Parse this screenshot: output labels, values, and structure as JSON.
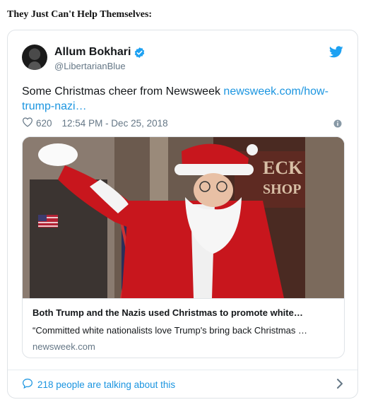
{
  "page": {
    "heading": "They Just Can't Help Themselves:"
  },
  "tweet": {
    "author_name": "Allum Bokhari",
    "handle": "@LibertarianBlue",
    "text_prefix": "Some Christmas cheer from Newsweek ",
    "link_text": "newsweek.com/how-trump-nazi…",
    "likes": "620",
    "timestamp": "12:54 PM - Dec 25, 2018",
    "colors": {
      "link": "#1b95e0",
      "verified": "#1da1f2",
      "bird": "#1da1f2",
      "muted": "#657786"
    }
  },
  "link_card": {
    "title": "Both Trump and the Nazis used Christmas to promote white…",
    "description": "“Committed white nationalists love Trump's bring back Christmas …",
    "domain": "newsweek.com",
    "photo_sign_text": "ECK",
    "photo_sign_text2": "SHOP"
  },
  "footer": {
    "talking": "218 people are talking about this"
  },
  "icons": [
    "verified-icon",
    "twitter-bird-icon",
    "heart-icon",
    "info-icon",
    "speech-bubble-icon",
    "chevron-right-icon"
  ]
}
